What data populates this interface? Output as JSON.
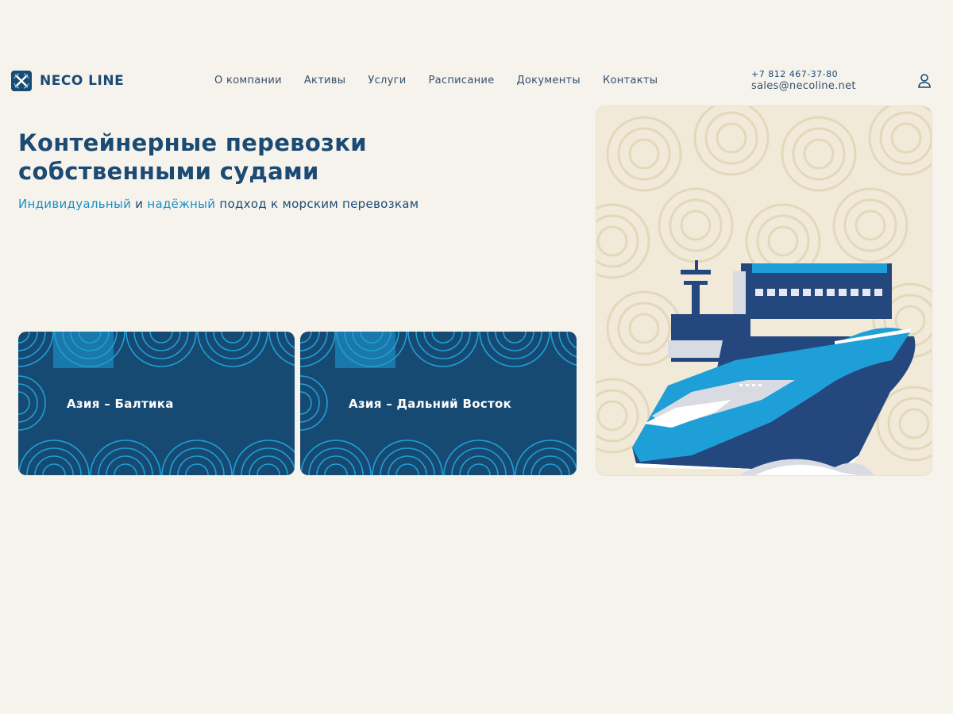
{
  "brand": {
    "name": "NECO LINE",
    "logo_icon": "crossed-anchors-icon"
  },
  "nav": {
    "items": [
      {
        "label": "О компании"
      },
      {
        "label": "Активы"
      },
      {
        "label": "Услуги"
      },
      {
        "label": "Расписание"
      },
      {
        "label": "Документы"
      },
      {
        "label": "Контакты"
      }
    ]
  },
  "contacts": {
    "phone": "+7 812 467-37-80",
    "email": "sales@necoline.net"
  },
  "account": {
    "icon": "user-icon"
  },
  "hero": {
    "title_line1": "Контейнерные перевозки",
    "title_line2": "собственными судами",
    "subtitle_hl1": "Индивидуальный",
    "subtitle_and": " и ",
    "subtitle_hl2": "надёжный",
    "subtitle_rest": " подход к морским перевозкам"
  },
  "routes": [
    {
      "label": "Азия – Балтика"
    },
    {
      "label": "Азия – Дальний Восток"
    }
  ],
  "illustration": {
    "icon": "container-ship-illustration"
  },
  "colors": {
    "background": "#f6f3ed",
    "primary": "#1b4a73",
    "accent": "#1a8fc7",
    "card": "#174a73",
    "card_pattern": "#1e9fd8"
  }
}
